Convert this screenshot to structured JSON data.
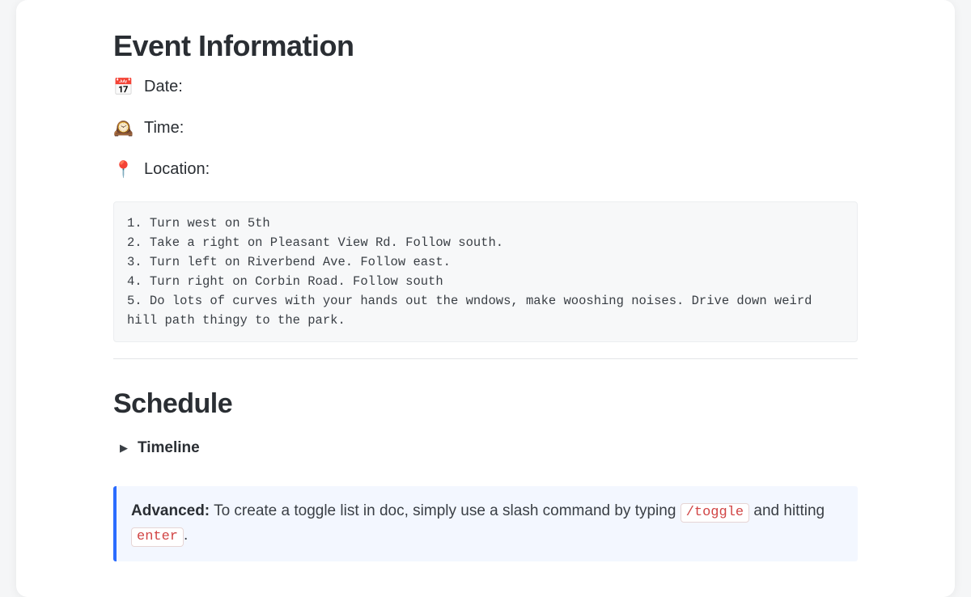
{
  "eventInfo": {
    "heading": "Event Information",
    "rows": [
      {
        "icon": "📅",
        "label": "Date:"
      },
      {
        "icon": "🕰️",
        "label": "Time:"
      },
      {
        "icon": "📍",
        "label": "Location:"
      }
    ],
    "directions": "1. Turn west on 5th\n2. Take a right on Pleasant View Rd. Follow south.\n3. Turn left on Riverbend Ave. Follow east.\n4. Turn right on Corbin Road. Follow south\n5. Do lots of curves with your hands out the wndows, make wooshing noises. Drive down weird hill path thingy to the park."
  },
  "schedule": {
    "heading": "Schedule",
    "toggleLabel": "Timeline"
  },
  "callout": {
    "strong": "Advanced:",
    "text1": " To create a toggle list in doc, simply use a slash command by typing ",
    "code1": "/toggle",
    "text2": " and hitting ",
    "code2": "enter",
    "text3": "."
  }
}
